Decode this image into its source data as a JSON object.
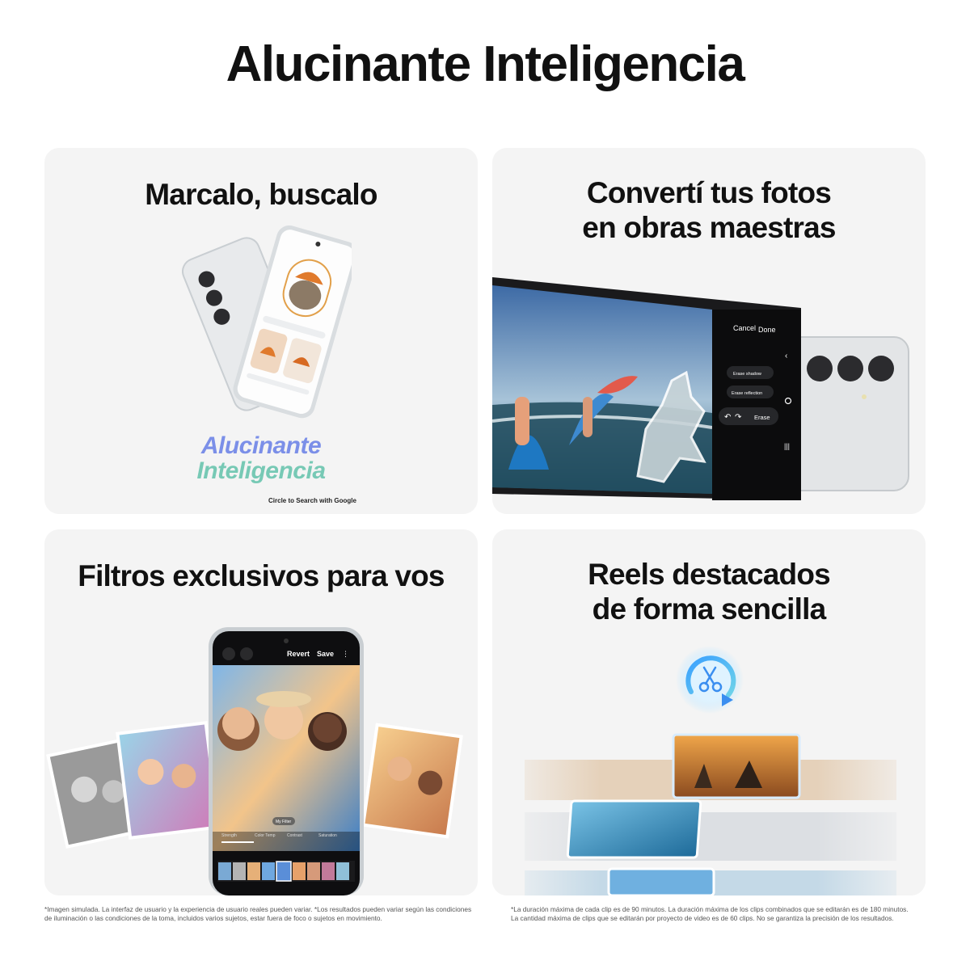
{
  "page": {
    "title": "Alucinante Inteligencia"
  },
  "cards": [
    {
      "title_lines": [
        "Marcalo, buscalo"
      ],
      "brand_lines": [
        "Alucinante",
        "Inteligencia"
      ],
      "caption": "Circle to Search with",
      "caption_brand": "Google"
    },
    {
      "title_lines": [
        "Convertí tus fotos",
        "en obras maestras"
      ],
      "ui": {
        "cancel": "Cancel",
        "done": "Done",
        "erase_shadow": "Erase shadow",
        "erase_reflection": "Erase reflection",
        "erase": "Erase"
      }
    },
    {
      "title_lines": [
        "Filtros exclusivos para vos"
      ],
      "ui": {
        "revert": "Revert",
        "save": "Save",
        "my_filter": "My Filter",
        "sliders": [
          "Strength",
          "Color Temp",
          "Contrast",
          "Saturation"
        ]
      }
    },
    {
      "title_lines": [
        "Reels destacados",
        "de forma sencilla"
      ]
    }
  ],
  "footnotes": {
    "left": [
      "*Imagen simulada. La interfaz de usuario y la experiencia de usuario reales pueden variar. *Los resultados pueden variar según las condiciones",
      "de iluminación o las condiciones de la toma, incluidos varios sujetos, estar fuera de foco o sujetos en movimiento."
    ],
    "right": [
      "*La duración máxima de cada clip es de 90 minutos. La duración máxima de los clips combinados que se editarán es de 180 minutos.",
      "La cantidad máxima de clips que se editarán por proyecto de video es de 60 clips. No se garantiza la precisión de los resultados."
    ]
  },
  "colors": {
    "card_bg": "#f4f4f4",
    "brand_blue": "#7b8fe8",
    "brand_green": "#77c9b5",
    "phone_frame": "#d9dde0"
  },
  "icons": [
    "phone-image",
    "video-edit-icon",
    "photo-thumbnails"
  ]
}
